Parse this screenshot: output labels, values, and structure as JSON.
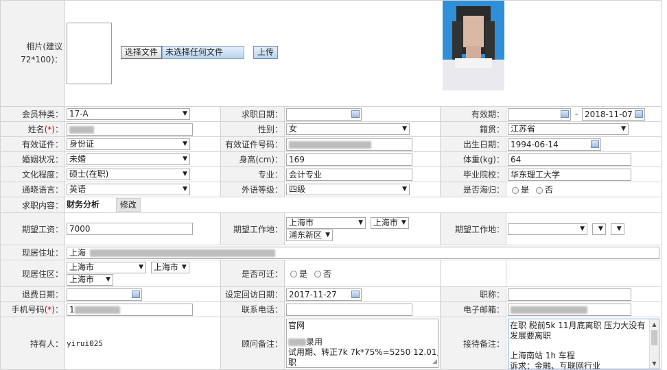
{
  "photo_section": {
    "label": "相片(建议72*100)：",
    "choose_file_button": "选择文件",
    "no_file_text": "未选择任何文件",
    "upload_button": "上传"
  },
  "row_member_type": {
    "label": "会员种类：",
    "value": "17-A",
    "job_date_label": "求职日期：",
    "job_date_value": "",
    "validity_label": "有效期：",
    "validity_start": "",
    "validity_sep": "-",
    "validity_end": "2018-11-07"
  },
  "row_name": {
    "label": "姓名",
    "required_mark": "(*)",
    "label_suffix": "：",
    "gender_label": "性别：",
    "gender_value": "女",
    "native_label": "籍贯：",
    "native_value": "江苏省"
  },
  "row_id": {
    "label": "有效证件：",
    "value": "身份证",
    "id_no_label": "有效证件号码：",
    "birth_label": "出生日期：",
    "birth_value": "1994-06-14"
  },
  "row_marriage": {
    "label": "婚姻状况：",
    "value": "未婚",
    "height_label": "身高(cm)：",
    "height_value": "169",
    "weight_label": "体重(kg)：",
    "weight_value": "64"
  },
  "row_education": {
    "label": "文化程度：",
    "value": "硕士(在职)",
    "major_label": "专业：",
    "major_value": "会计专业",
    "school_label": "毕业院校：",
    "school_value": "华东理工大学"
  },
  "row_language": {
    "label": "通晓语言：",
    "value": "英语",
    "level_label": "外语等级：",
    "level_value": "四级",
    "overseas_label": "是否海归：",
    "yes": "是",
    "no": "否"
  },
  "row_job_content": {
    "label": "求职内容：",
    "value": "财务分析",
    "edit_button": "修改"
  },
  "row_salary": {
    "label": "期望工资：",
    "value": "7000",
    "location_label": "期望工作地：",
    "loc1": "上海市",
    "loc2": "上海市",
    "loc3": "浦东新区",
    "location2_label": "期望工作地："
  },
  "row_address": {
    "label": "现居住址：",
    "value": "上海"
  },
  "row_district": {
    "label": "现居住区：",
    "d1": "上海市",
    "d2": "上海市",
    "d3": "上海市",
    "relocate_label": "是否可迁：",
    "yes": "是",
    "no": "否"
  },
  "row_refund": {
    "label": "退费日期：",
    "visit_label": "设定回访日期：",
    "visit_value": "2017-11-27",
    "title_label": "职称："
  },
  "row_phone": {
    "label": "手机号码",
    "required_mark": "(*)",
    "label_suffix": "：",
    "value_prefix": "1",
    "tel_label": "联系电话：",
    "email_label": "电子邮箱："
  },
  "row_holder": {
    "label": "持有人：",
    "value": "yirui025",
    "consultant_label": "顾问备注：",
    "consultant_line1": "官网",
    "consultant_line2": "录用",
    "consultant_line3": "试用期、转正7k 7k*75%=5250  12.01入",
    "consultant_line4": "职",
    "reception_label": "接待备注：",
    "reception_line1": "在职 税前5k 11月底离职 压力大没有",
    "reception_line2": "发展要离职",
    "reception_line3": "上海南站 1h 车程",
    "reception_line4": "诉求：金融、互联网行业"
  }
}
